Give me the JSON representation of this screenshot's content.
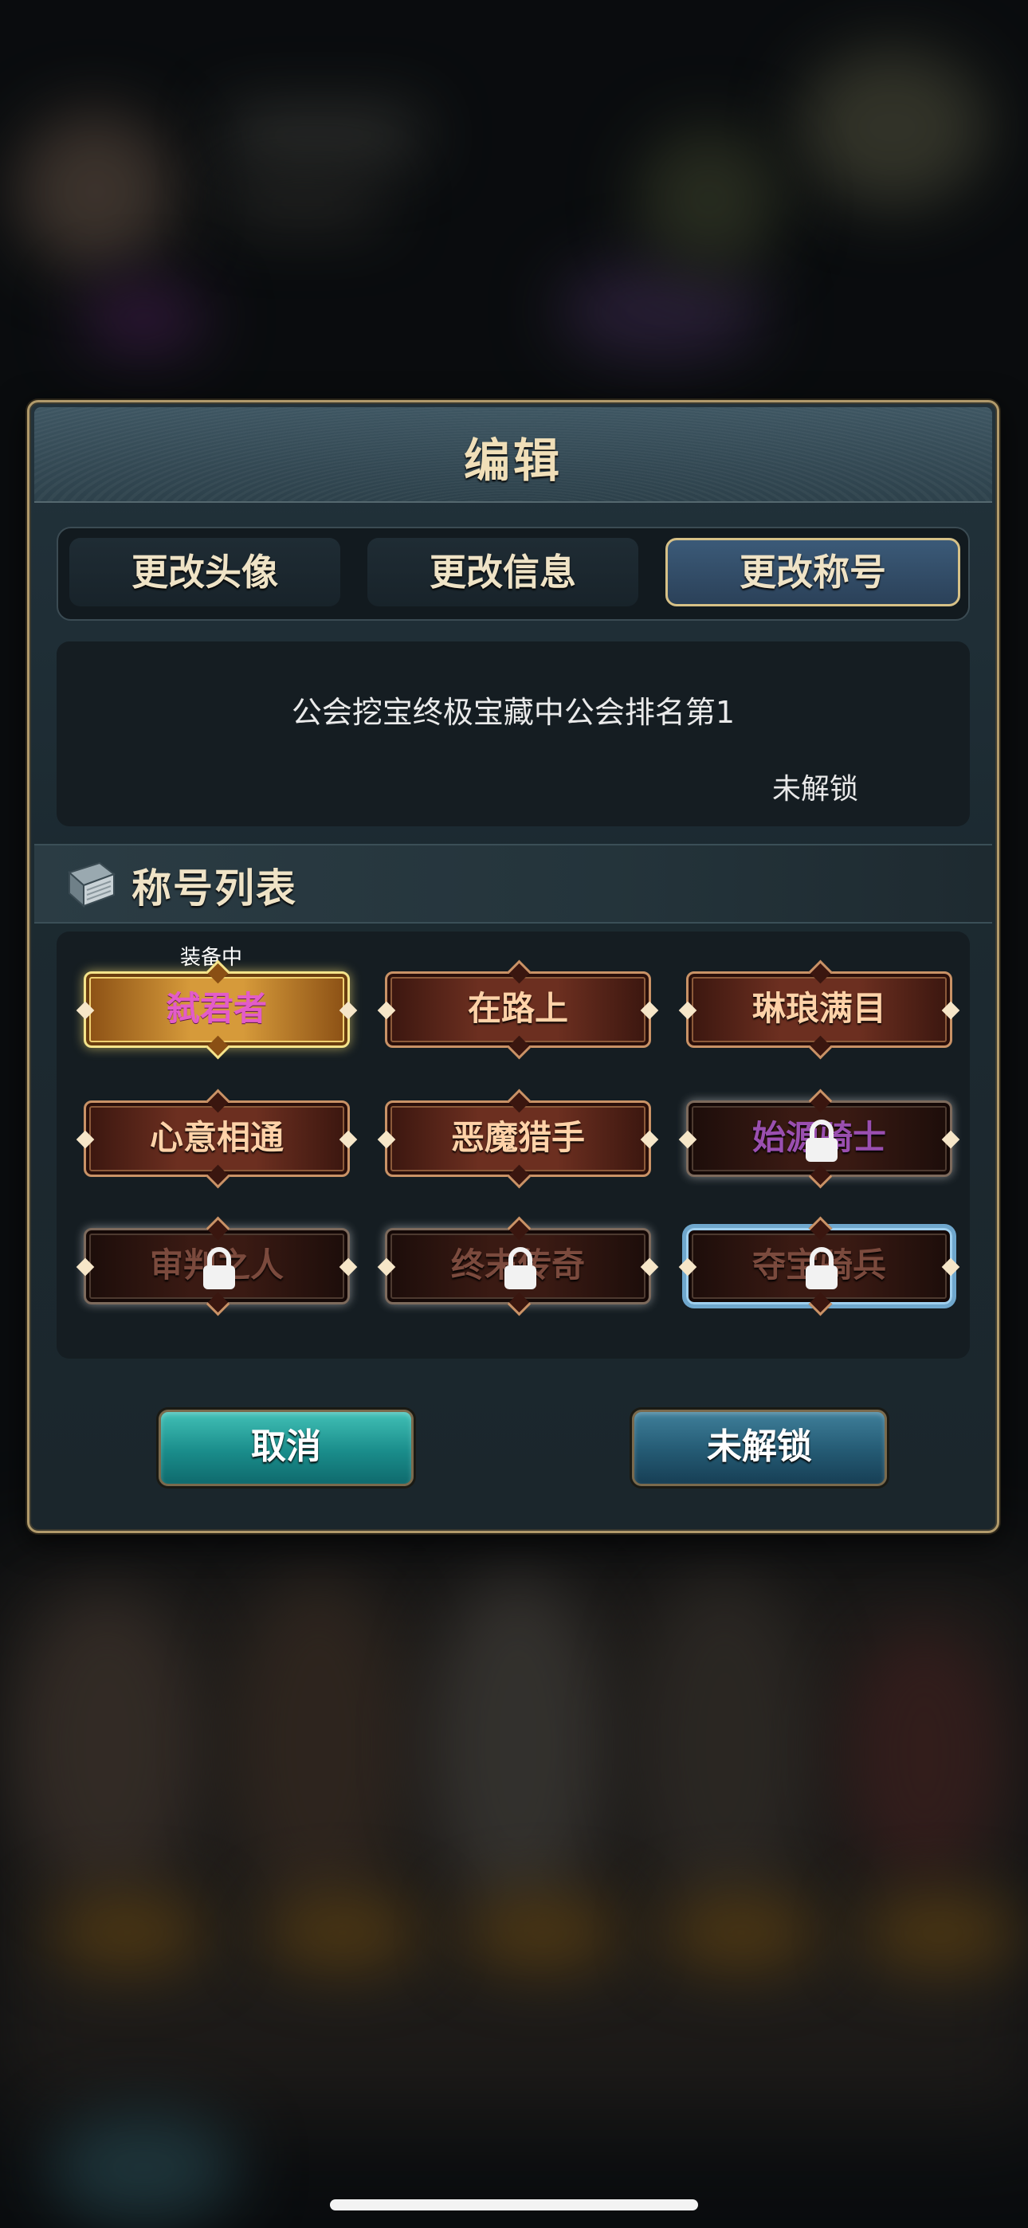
{
  "dialog": {
    "title": "编辑",
    "tabs": [
      {
        "label": "更改头像",
        "active": false
      },
      {
        "label": "更改信息",
        "active": false
      },
      {
        "label": "更改称号",
        "active": true
      }
    ],
    "info": {
      "description": "公会挖宝终极宝藏中公会排名第1",
      "status": "未解锁"
    },
    "section": {
      "title": "称号列表",
      "icon": "book-icon"
    },
    "equipped_label": "装备中",
    "titles": [
      {
        "label": "弑君者",
        "state": "equipped"
      },
      {
        "label": "在路上",
        "state": "unlocked"
      },
      {
        "label": "琳琅满目",
        "state": "unlocked"
      },
      {
        "label": "心意相通",
        "state": "unlocked"
      },
      {
        "label": "恶魔猎手",
        "state": "unlocked"
      },
      {
        "label": "始源骑士",
        "state": "locked"
      },
      {
        "label": "审判之人",
        "state": "locked"
      },
      {
        "label": "终末传奇",
        "state": "locked"
      },
      {
        "label": "夺宝骑兵",
        "state": "locked-selected"
      }
    ],
    "buttons": {
      "cancel": "取消",
      "confirm": "未解锁"
    }
  },
  "colors": {
    "accent_gold": "#f0dfb8",
    "equipped_text": "#e35cc9",
    "cancel_button": "#1a8d8b",
    "confirm_button": "#245a73",
    "selected_outline": "#6fa7cd"
  }
}
